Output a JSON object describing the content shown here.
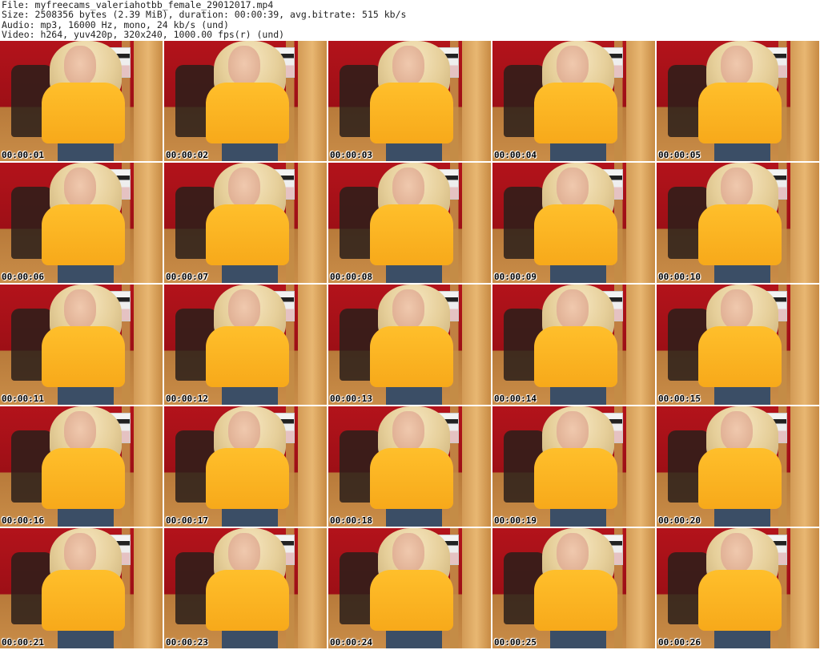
{
  "info": {
    "file": "File: myfreecams_valeriahotbb_female_29012017.mp4",
    "size": "Size: 2508356 bytes (2.39 MiB), duration: 00:00:39, avg.bitrate: 515 kb/s",
    "audio": "Audio: mp3, 16000 Hz, mono, 24 kb/s (und)",
    "video": "Video: h264, yuv420p, 320x240, 1000.00 fps(r) (und)"
  },
  "thumbnails": [
    {
      "time": "00:00:01"
    },
    {
      "time": "00:00:02"
    },
    {
      "time": "00:00:03"
    },
    {
      "time": "00:00:04"
    },
    {
      "time": "00:00:05"
    },
    {
      "time": "00:00:06"
    },
    {
      "time": "00:00:07"
    },
    {
      "time": "00:00:08"
    },
    {
      "time": "00:00:09"
    },
    {
      "time": "00:00:10"
    },
    {
      "time": "00:00:11"
    },
    {
      "time": "00:00:12"
    },
    {
      "time": "00:00:13"
    },
    {
      "time": "00:00:14"
    },
    {
      "time": "00:00:15"
    },
    {
      "time": "00:00:16"
    },
    {
      "time": "00:00:17"
    },
    {
      "time": "00:00:18"
    },
    {
      "time": "00:00:19"
    },
    {
      "time": "00:00:20"
    },
    {
      "time": "00:00:21"
    },
    {
      "time": "00:00:23"
    },
    {
      "time": "00:00:24"
    },
    {
      "time": "00:00:25"
    },
    {
      "time": "00:00:26"
    }
  ]
}
